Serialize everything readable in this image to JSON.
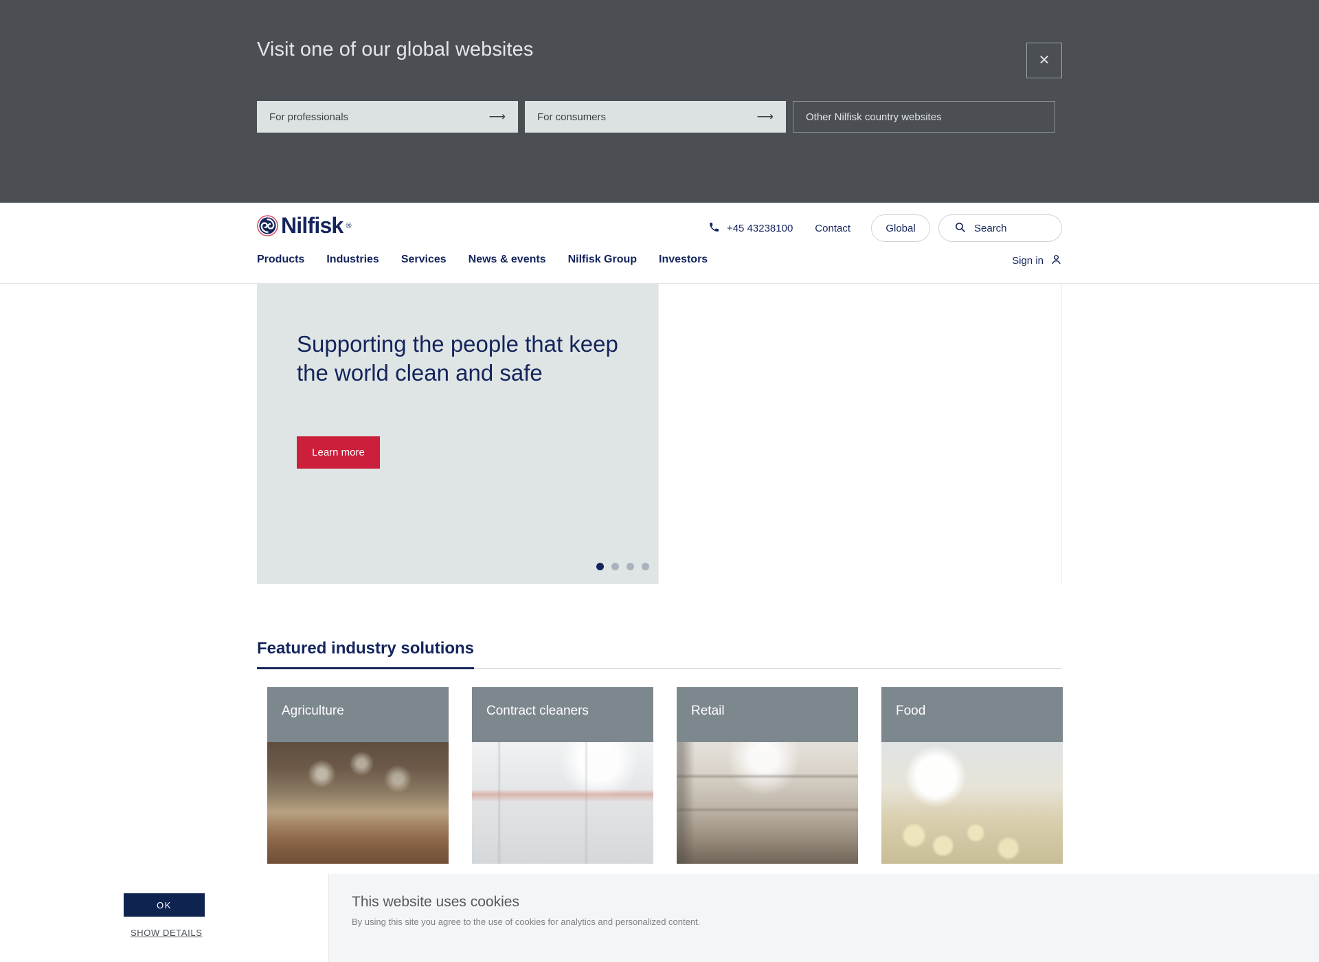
{
  "global_banner": {
    "title": "Visit one of our global websites",
    "close_icon": "close-icon",
    "options": [
      {
        "label": "For professionals",
        "arrow": "⟶",
        "style": "filled"
      },
      {
        "label": "For consumers",
        "arrow": "⟶",
        "style": "filled"
      },
      {
        "label": "Other Nilfisk country websites",
        "arrow": "",
        "style": "outlined"
      }
    ],
    "background_color": "#4b4f54"
  },
  "header": {
    "logo_text": "Nilfisk",
    "logo_registered": "®",
    "logo_mark_icon": "nilfisk-swirl-icon",
    "phone_icon": "phone-icon",
    "phone": "+45 43238100",
    "contact_label": "Contact",
    "global_label": "Global",
    "search_icon": "search-icon",
    "search_label": "Search",
    "signin_label": "Sign in",
    "signin_icon": "user-icon",
    "nav": [
      {
        "label": "Products"
      },
      {
        "label": "Industries"
      },
      {
        "label": "Services"
      },
      {
        "label": "News & events"
      },
      {
        "label": "Nilfisk Group"
      },
      {
        "label": "Investors"
      }
    ],
    "brand_navy": "#14245c"
  },
  "hero": {
    "title": "Supporting the people that keep the world clean and safe",
    "cta_label": "Learn more",
    "cta_color": "#cb1f3b",
    "background_color": "#dfe5e4",
    "dots": {
      "total": 4,
      "active_index": 0
    }
  },
  "featured": {
    "heading": "Featured industry solutions",
    "cards": [
      {
        "label": "Agriculture",
        "photo": "photo-agriculture"
      },
      {
        "label": "Contract cleaners",
        "photo": "photo-contract"
      },
      {
        "label": "Retail",
        "photo": "photo-retail"
      },
      {
        "label": "Food",
        "photo": "photo-food"
      }
    ]
  },
  "cookie_banner": {
    "ok_label": "OK",
    "details_label": "SHOW DETAILS",
    "title": "This website uses cookies",
    "text": "By using this site you agree to the use of cookies for analytics and personalized content.",
    "ok_color": "#0f2350"
  }
}
